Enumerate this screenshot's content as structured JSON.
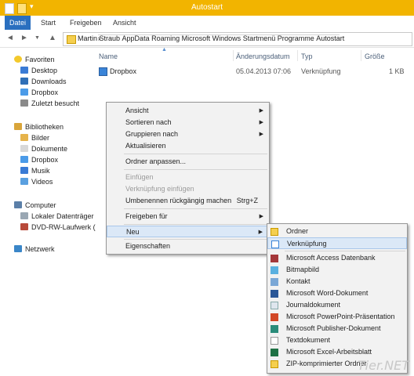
{
  "window": {
    "title": "Autostart"
  },
  "ribbon": {
    "tabs": [
      "Datei",
      "Start",
      "Freigeben",
      "Ansicht"
    ]
  },
  "address": {
    "crumbs": [
      "Martin Straub",
      "AppData",
      "Roaming",
      "Microsoft",
      "Windows",
      "Startmenü",
      "Programme",
      "Autostart"
    ]
  },
  "nav": {
    "favorites": {
      "label": "Favoriten",
      "items": [
        "Desktop",
        "Downloads",
        "Dropbox",
        "Zuletzt besucht"
      ]
    },
    "libraries": {
      "label": "Bibliotheken",
      "items": [
        "Bilder",
        "Dokumente",
        "Dropbox",
        "Musik",
        "Videos"
      ]
    },
    "computer": {
      "label": "Computer",
      "items": [
        "Lokaler Datenträger",
        "DVD-RW-Laufwerk ("
      ]
    },
    "network": {
      "label": "Netzwerk"
    }
  },
  "columns": {
    "name": "Name",
    "date": "Änderungsdatum",
    "type": "Typ",
    "size": "Größe"
  },
  "files": [
    {
      "name": "Dropbox",
      "date": "05.04.2013 07:06",
      "type": "Verknüpfung",
      "size": "1 KB"
    }
  ],
  "context_menu": {
    "items": [
      {
        "label": "Ansicht",
        "submenu": true
      },
      {
        "label": "Sortieren nach",
        "submenu": true
      },
      {
        "label": "Gruppieren nach",
        "submenu": true
      },
      {
        "label": "Aktualisieren"
      },
      {
        "label": "Ordner anpassen..."
      },
      {
        "label": "Einfügen",
        "disabled": true
      },
      {
        "label": "Verknüpfung einfügen",
        "disabled": true
      },
      {
        "label": "Umbenennen rückgängig machen",
        "shortcut": "Strg+Z"
      },
      {
        "label": "Freigeben für",
        "submenu": true
      },
      {
        "label": "Neu",
        "submenu": true,
        "highlighted": true
      },
      {
        "label": "Eigenschaften"
      }
    ]
  },
  "new_submenu": {
    "items": [
      {
        "label": "Ordner",
        "icon": "folder-icon"
      },
      {
        "label": "Verknüpfung",
        "icon": "shortcut-icon",
        "highlighted": true
      },
      {
        "label": "Microsoft Access Datenbank",
        "icon": "access-icon"
      },
      {
        "label": "Bitmapbild",
        "icon": "bitmap-icon"
      },
      {
        "label": "Kontakt",
        "icon": "contact-icon"
      },
      {
        "label": "Microsoft Word-Dokument",
        "icon": "word-icon"
      },
      {
        "label": "Journaldokument",
        "icon": "journal-icon"
      },
      {
        "label": "Microsoft PowerPoint-Präsentation",
        "icon": "powerpoint-icon"
      },
      {
        "label": "Microsoft Publisher-Dokument",
        "icon": "publisher-icon"
      },
      {
        "label": "Textdokument",
        "icon": "text-document-icon"
      },
      {
        "label": "Microsoft Excel-Arbeitsblatt",
        "icon": "excel-icon"
      },
      {
        "label": "ZIP-komprimierter Ordner",
        "icon": "zip-folder-icon"
      }
    ]
  },
  "watermark": "Tier.NET",
  "colors": {
    "titlebar": "#f2b400",
    "file_tab": "#2a6fbf",
    "highlight": "#dbe8f7"
  }
}
